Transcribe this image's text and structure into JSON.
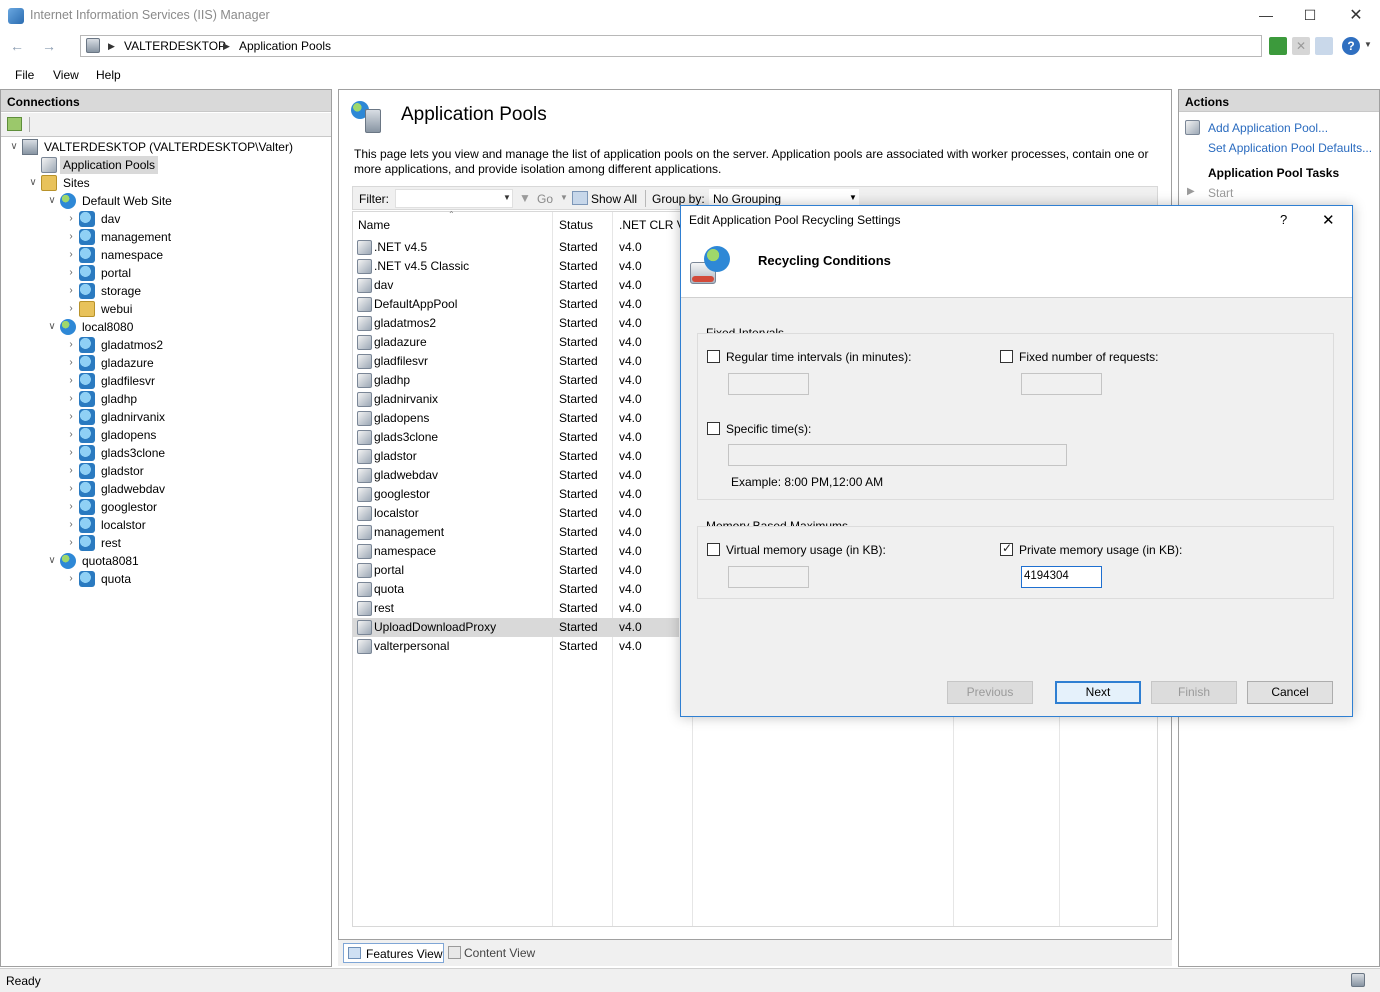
{
  "window": {
    "title": "Internet Information Services (IIS) Manager"
  },
  "address": {
    "crumbs": [
      "VALTERDESKTOP",
      "Application Pools"
    ]
  },
  "menu": {
    "items": [
      "File",
      "View",
      "Help"
    ]
  },
  "connections": {
    "header": "Connections",
    "tree": [
      {
        "label": "VALTERDESKTOP (VALTERDESKTOP\\Valter)",
        "level": 0,
        "icon": "server-icon"
      },
      {
        "label": "Application Pools",
        "level": 1,
        "icon": "app-pool-icon",
        "selected": true
      },
      {
        "label": "Sites",
        "level": 1,
        "icon": "folder-icon"
      },
      {
        "label": "Default Web Site",
        "level": 2,
        "icon": "globe-icon"
      },
      {
        "label": "dav",
        "level": 3,
        "icon": "app-icon"
      },
      {
        "label": "management",
        "level": 3,
        "icon": "app-icon"
      },
      {
        "label": "namespace",
        "level": 3,
        "icon": "app-icon"
      },
      {
        "label": "portal",
        "level": 3,
        "icon": "app-icon"
      },
      {
        "label": "storage",
        "level": 3,
        "icon": "app-icon"
      },
      {
        "label": "webui",
        "level": 3,
        "icon": "folder-icon"
      },
      {
        "label": "local8080",
        "level": 2,
        "icon": "globe-icon"
      },
      {
        "label": "gladatmos2",
        "level": 3,
        "icon": "app-icon"
      },
      {
        "label": "gladazure",
        "level": 3,
        "icon": "app-icon"
      },
      {
        "label": "gladfilesvr",
        "level": 3,
        "icon": "app-icon"
      },
      {
        "label": "gladhp",
        "level": 3,
        "icon": "app-icon"
      },
      {
        "label": "gladnirvanix",
        "level": 3,
        "icon": "app-icon"
      },
      {
        "label": "gladopens",
        "level": 3,
        "icon": "app-icon"
      },
      {
        "label": "glads3clone",
        "level": 3,
        "icon": "app-icon"
      },
      {
        "label": "gladstor",
        "level": 3,
        "icon": "app-icon"
      },
      {
        "label": "gladwebdav",
        "level": 3,
        "icon": "app-icon"
      },
      {
        "label": "googlestor",
        "level": 3,
        "icon": "app-icon"
      },
      {
        "label": "localstor",
        "level": 3,
        "icon": "app-icon"
      },
      {
        "label": "rest",
        "level": 3,
        "icon": "app-icon"
      },
      {
        "label": "quota8081",
        "level": 2,
        "icon": "globe-icon"
      },
      {
        "label": "quota",
        "level": 3,
        "icon": "app-icon"
      }
    ]
  },
  "main": {
    "title": "Application Pools",
    "description": "This page lets you view and manage the list of application pools on the server. Application pools are associated with worker processes, contain one or more applications, and provide isolation among different applications.",
    "filter": {
      "label": "Filter:",
      "go": "Go",
      "show_all": "Show All",
      "group_by_label": "Group by:",
      "group_by_value": "No Grouping"
    },
    "columns": [
      "Name",
      "Status",
      ".NET CLR V..."
    ],
    "rows": [
      {
        "name": ".NET v4.5",
        "status": "Started",
        "clr": "v4.0"
      },
      {
        "name": ".NET v4.5 Classic",
        "status": "Started",
        "clr": "v4.0"
      },
      {
        "name": "dav",
        "status": "Started",
        "clr": "v4.0"
      },
      {
        "name": "DefaultAppPool",
        "status": "Started",
        "clr": "v4.0"
      },
      {
        "name": "gladatmos2",
        "status": "Started",
        "clr": "v4.0"
      },
      {
        "name": "gladazure",
        "status": "Started",
        "clr": "v4.0"
      },
      {
        "name": "gladfilesvr",
        "status": "Started",
        "clr": "v4.0"
      },
      {
        "name": "gladhp",
        "status": "Started",
        "clr": "v4.0"
      },
      {
        "name": "gladnirvanix",
        "status": "Started",
        "clr": "v4.0"
      },
      {
        "name": "gladopens",
        "status": "Started",
        "clr": "v4.0"
      },
      {
        "name": "glads3clone",
        "status": "Started",
        "clr": "v4.0"
      },
      {
        "name": "gladstor",
        "status": "Started",
        "clr": "v4.0"
      },
      {
        "name": "gladwebdav",
        "status": "Started",
        "clr": "v4.0"
      },
      {
        "name": "googlestor",
        "status": "Started",
        "clr": "v4.0"
      },
      {
        "name": "localstor",
        "status": "Started",
        "clr": "v4.0"
      },
      {
        "name": "management",
        "status": "Started",
        "clr": "v4.0"
      },
      {
        "name": "namespace",
        "status": "Started",
        "clr": "v4.0"
      },
      {
        "name": "portal",
        "status": "Started",
        "clr": "v4.0"
      },
      {
        "name": "quota",
        "status": "Started",
        "clr": "v4.0"
      },
      {
        "name": "rest",
        "status": "Started",
        "clr": "v4.0"
      },
      {
        "name": "UploadDownloadProxy",
        "status": "Started",
        "clr": "v4.0",
        "selected": true
      },
      {
        "name": "valterpersonal",
        "status": "Started",
        "clr": "v4.0"
      }
    ],
    "view_tabs": {
      "features": "Features View",
      "content": "Content View"
    }
  },
  "actions": {
    "header": "Actions",
    "add_pool": "Add Application Pool...",
    "set_defaults": "Set Application Pool Defaults...",
    "tasks_header": "Application Pool Tasks",
    "start": "Start"
  },
  "status": {
    "text": "Ready"
  },
  "dialog": {
    "title": "Edit Application Pool Recycling Settings",
    "help": "?",
    "close": "✕",
    "heading": "Recycling Conditions",
    "fixed_intervals": {
      "legend": "Fixed Intervals",
      "regular_time": {
        "label": "Regular time intervals (in minutes):",
        "checked": false,
        "value": ""
      },
      "fixed_requests": {
        "label": "Fixed number of requests:",
        "checked": false,
        "value": ""
      },
      "specific_times": {
        "label": "Specific time(s):",
        "checked": false,
        "value": ""
      },
      "example": "Example: 8:00 PM,12:00 AM"
    },
    "memory": {
      "legend": "Memory Based Maximums",
      "virtual": {
        "label": "Virtual memory usage (in KB):",
        "checked": false,
        "value": ""
      },
      "private": {
        "label": "Private memory usage (in KB):",
        "checked": true,
        "value": "4194304"
      }
    },
    "buttons": {
      "previous": "Previous",
      "next": "Next",
      "finish": "Finish",
      "cancel": "Cancel"
    }
  }
}
